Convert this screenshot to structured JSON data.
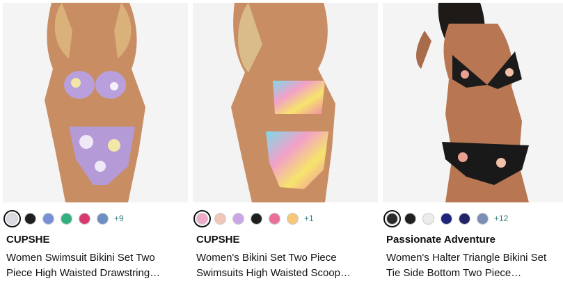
{
  "products": [
    {
      "brand": "CUPSHE",
      "title_line1": "Women Swimsuit Bikini Set Two",
      "title_line2": "Piece High Waisted Drawstring…",
      "more_colors": "+9",
      "swatch_colors": [
        "#dcd9e3",
        "#1f1f1f",
        "#7b8fd6",
        "#33b07d",
        "#d93a6d",
        "#6d8fc2"
      ],
      "selected_swatch": 0,
      "image_icon": "swimsuit-photo-icon"
    },
    {
      "brand": "CUPSHE",
      "title_line1": "Women's Bikini Set Two Piece",
      "title_line2": "Swimsuits High Waisted Scoop…",
      "more_colors": "+1",
      "swatch_colors": [
        "#f1a9c9",
        "#f0c7b8",
        "#c9a6e6",
        "#1f1f1f",
        "#ea6f98",
        "#f6c87a"
      ],
      "selected_swatch": 0,
      "image_icon": "swimsuit-photo-icon"
    },
    {
      "brand": "Passionate Adventure",
      "title_line1": "Women's Halter Triangle Bikini Set",
      "title_line2": "Tie Side Bottom Two Piece…",
      "more_colors": "+12",
      "swatch_colors": [
        "#2a2a2a",
        "#1f1f1f",
        "#ececec",
        "#1e237a",
        "#232468",
        "#7c8eb5"
      ],
      "selected_swatch": 0,
      "image_icon": "swimsuit-photo-icon"
    }
  ]
}
